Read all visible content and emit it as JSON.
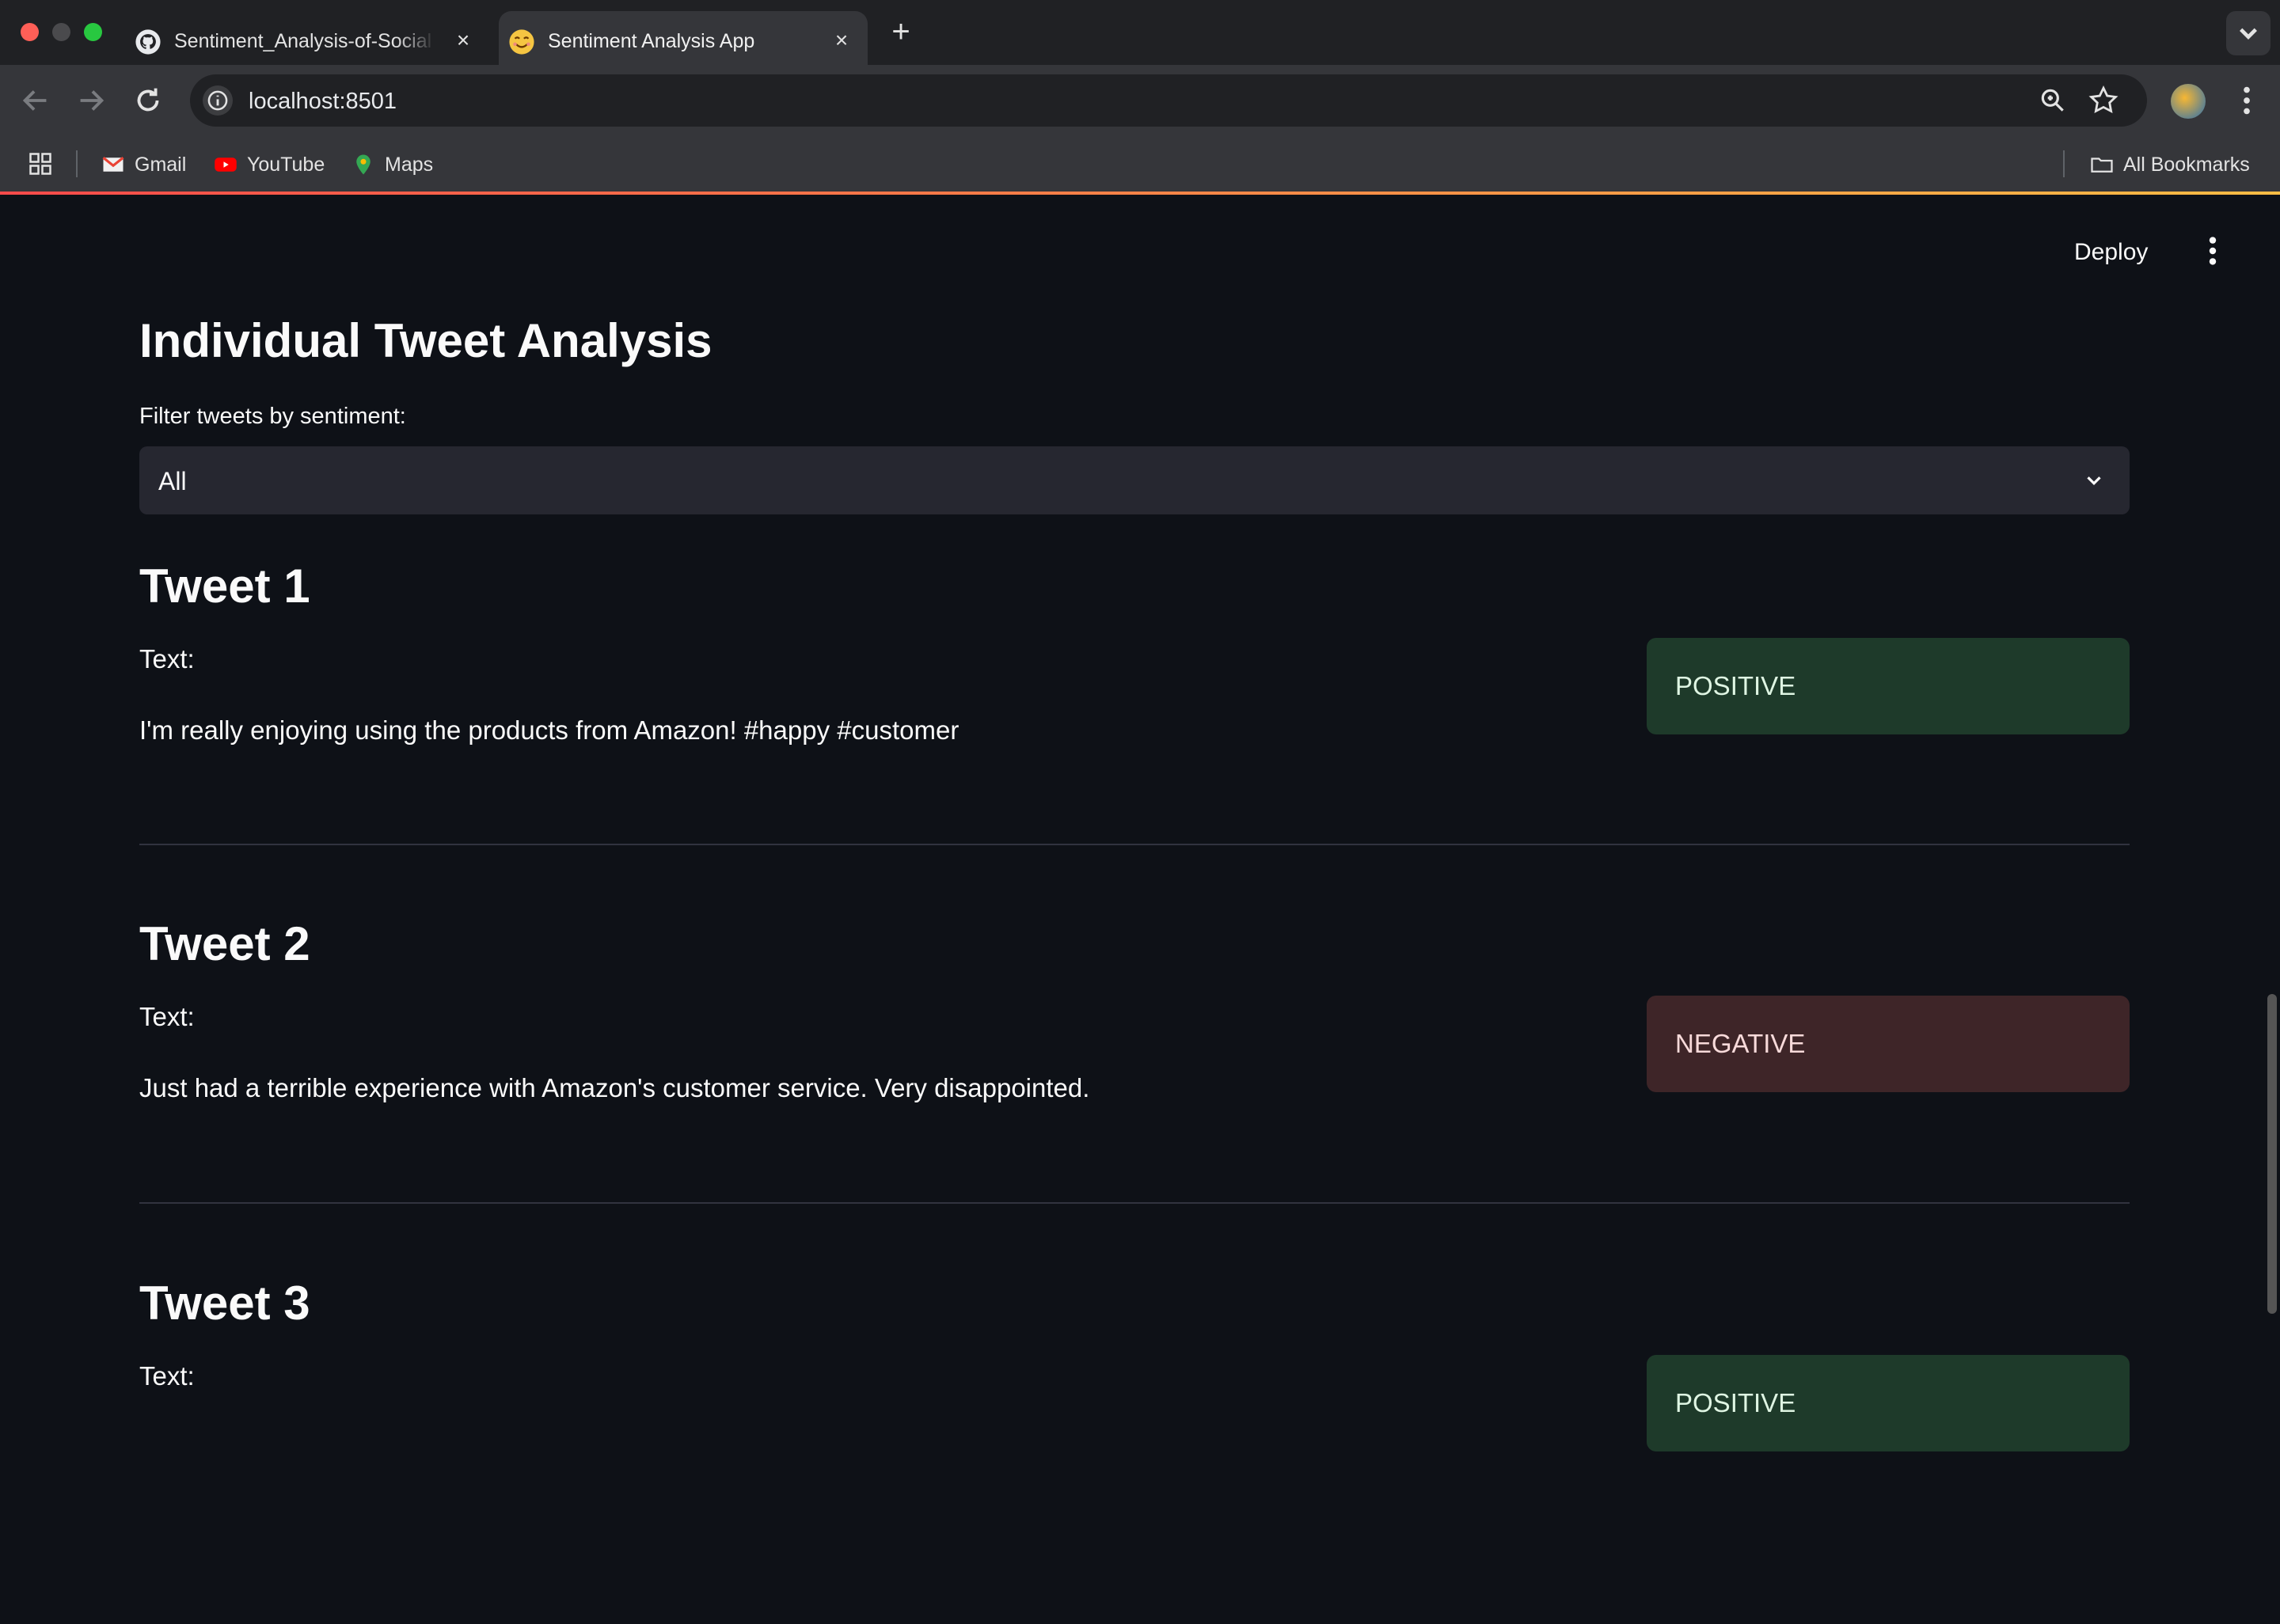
{
  "browser": {
    "tabs": [
      {
        "title": "Sentiment_Analysis-of-Social",
        "icon": "github-icon",
        "active": false
      },
      {
        "title": "Sentiment Analysis App",
        "icon": "smiley-icon",
        "active": true
      }
    ],
    "url": "localhost:8501",
    "bookmarks": [
      {
        "label": "Gmail",
        "icon": "gmail-icon"
      },
      {
        "label": "YouTube",
        "icon": "youtube-icon"
      },
      {
        "label": "Maps",
        "icon": "maps-icon"
      }
    ],
    "all_bookmarks_label": "All Bookmarks"
  },
  "app": {
    "deploy_label": "Deploy",
    "title": "Individual Tweet Analysis",
    "filter": {
      "label": "Filter tweets by sentiment:",
      "value": "All"
    },
    "text_label": "Text:",
    "tweets": [
      {
        "heading": "Tweet 1",
        "text": "I'm really enjoying using the products from Amazon! #happy #customer",
        "sentiment": "POSITIVE"
      },
      {
        "heading": "Tweet 2",
        "text": "Just had a terrible experience with Amazon's customer service. Very disappointed.",
        "sentiment": "NEGATIVE"
      },
      {
        "heading": "Tweet 3",
        "text": "",
        "sentiment": "POSITIVE"
      }
    ]
  },
  "colors": {
    "background": "#0e1117",
    "positive_bg": "#1e3a2a",
    "negative_bg": "#3e2528",
    "select_bg": "#262730",
    "accent_gradient_start": "#ff4b4b",
    "accent_gradient_end": "#ffbd45"
  }
}
